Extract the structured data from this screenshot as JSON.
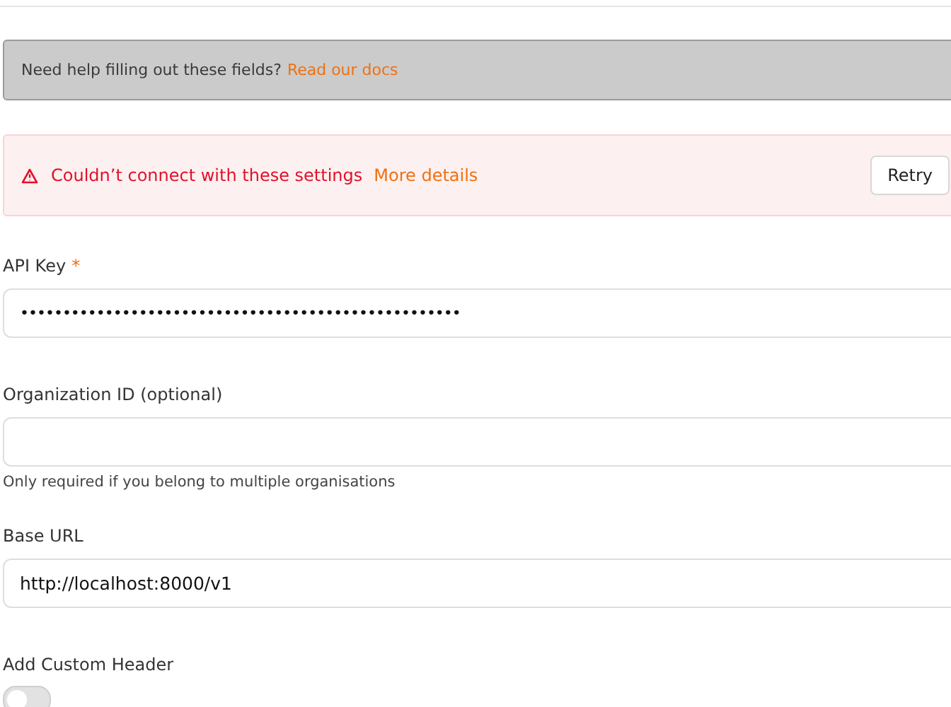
{
  "help_banner": {
    "text": "Need help filling out these fields?",
    "link": "Read our docs"
  },
  "error_banner": {
    "message": "Couldn’t connect with these settings",
    "link": "More details",
    "button": "Retry"
  },
  "fields": [
    {
      "label": "API Key",
      "required_mark": "*",
      "value": "••••••••••••••••••••••••••••••••••••••••••••••••••••"
    },
    {
      "label": "Organization ID (optional)",
      "hint": "Only required if you belong to multiple organisations"
    },
    {
      "label": "Base URL",
      "value": "http://localhost:8000/v1"
    }
  ],
  "custom_header": {
    "label": "Add Custom Header",
    "on": false
  }
}
